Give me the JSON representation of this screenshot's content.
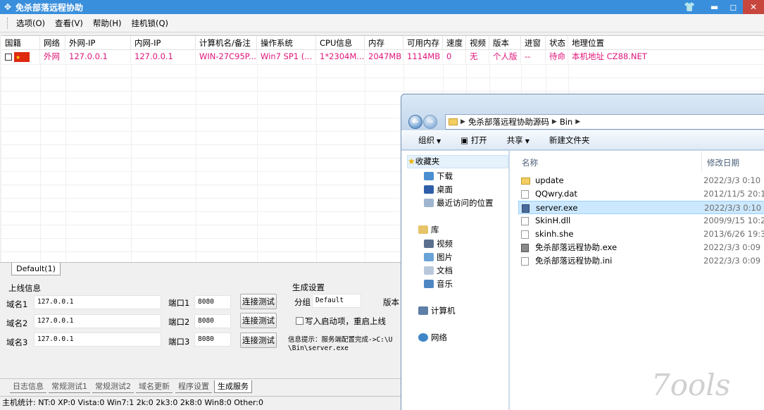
{
  "main": {
    "title": "免杀部落远程协助",
    "window_controls": {
      "minimize": "▬",
      "maximize": "◻",
      "close": "✕"
    }
  },
  "menu": [
    "选项(O)",
    "查看(V)",
    "帮助(H)",
    "挂机锁(Q)"
  ],
  "columns": [
    "国籍",
    "网络",
    "外网-IP",
    "内网-IP",
    "计算机名/备注",
    "操作系统",
    "CPU信息",
    "内存",
    "可用内存",
    "速度",
    "视频",
    "版本",
    "进窗",
    "状态",
    "地理位置"
  ],
  "rows": [
    {
      "network": "外网",
      "wan_ip": "127.0.0.1",
      "lan_ip": "127.0.0.1",
      "computer": "WIN-27C95P...",
      "os": "Win7 SP1 (...",
      "cpu": "1*2304M...",
      "memory": "2047MB",
      "free_memory": "1114MB",
      "speed": "0",
      "video": "无",
      "version": "个人版",
      "window": "--",
      "status": "待命",
      "location": "本机地址  CZ88.NET"
    }
  ],
  "group_tab": "Default(1)",
  "online_info": {
    "title": "上线信息",
    "domains": [
      {
        "label": "域名1",
        "value": "127.0.0.1",
        "port_label": "端口1",
        "port": "8080",
        "button": "连接测试"
      },
      {
        "label": "域名2",
        "value": "127.0.0.1",
        "port_label": "端口2",
        "port": "8080",
        "button": "连接测试"
      },
      {
        "label": "域名3",
        "value": "127.0.0.1",
        "port_label": "端口3",
        "port": "8080",
        "button": "连接测试"
      }
    ]
  },
  "build_settings": {
    "title": "生成设置",
    "group_label": "分组",
    "group_value": "Default",
    "version_label": "版本",
    "autostart_label": "写入启动项，重启上线",
    "info_line1": "信息提示：服务端配置完成->C:\\U",
    "info_line2": "\\Bin\\server.exe"
  },
  "bottom_tabs": [
    "日志信息",
    "常规测试1",
    "常规测试2",
    "域名更新",
    "程序设置",
    "生成服务"
  ],
  "status_bar": "主机统计: NT:0  XP:0  Vista:0  Win7:1  2k:0  2k3:0  2k8:0  Win8:0  Other:0",
  "explorer": {
    "path": [
      "免杀部落远程协助源码",
      "Bin"
    ],
    "commands": [
      "组织",
      "打开",
      "共享",
      "新建文件夹"
    ],
    "nav": {
      "favorites": "收藏夹",
      "favorites_items": [
        "下载",
        "桌面",
        "最近访问的位置"
      ],
      "library": "库",
      "library_items": [
        "视频",
        "图片",
        "文档",
        "音乐"
      ],
      "computer": "计算机",
      "network": "网络"
    },
    "headers": {
      "name": "名称",
      "date": "修改日期"
    },
    "files": [
      {
        "name": "update",
        "date": "2022/3/3 0:10",
        "kind": "folder"
      },
      {
        "name": "QQwry.dat",
        "date": "2012/11/5 20:1",
        "kind": "file"
      },
      {
        "name": "server.exe",
        "date": "2022/3/3 0:10",
        "kind": "exe"
      },
      {
        "name": "SkinH.dll",
        "date": "2009/9/15 10:2",
        "kind": "file"
      },
      {
        "name": "skinh.she",
        "date": "2013/6/26 19:3",
        "kind": "file"
      },
      {
        "name": "免杀部落远程协助.exe",
        "date": "2022/3/3 0:09",
        "kind": "app"
      },
      {
        "name": "免杀部落远程协助.ini",
        "date": "2022/3/3 0:09",
        "kind": "file"
      }
    ]
  },
  "colors": {
    "title_blue": "#3a8fdc",
    "row_pink": "#e0157a",
    "selection": "#cce8ff"
  }
}
